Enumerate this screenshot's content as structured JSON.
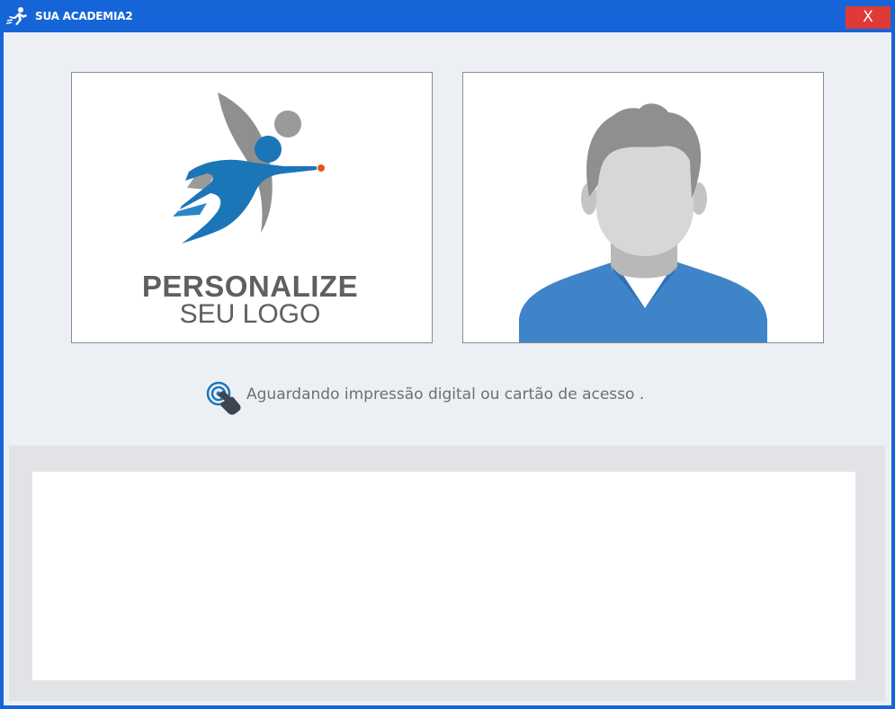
{
  "window": {
    "title": "SUA ACADEMIA2",
    "close_label": "X"
  },
  "logo": {
    "line1": "PERSONALIZE",
    "line2": "SEU LOGO"
  },
  "status": {
    "icon": "fingerprint-touch-icon",
    "text": "Aguardando impressão digital ou cartão de acesso ."
  },
  "colors": {
    "titlebar": "#1565d8",
    "close_button": "#e03a36",
    "background": "#ecf0f4",
    "brand_blue": "#1b76b8",
    "shirt_blue": "#3f84c9",
    "accent_orange": "#e8561c"
  }
}
